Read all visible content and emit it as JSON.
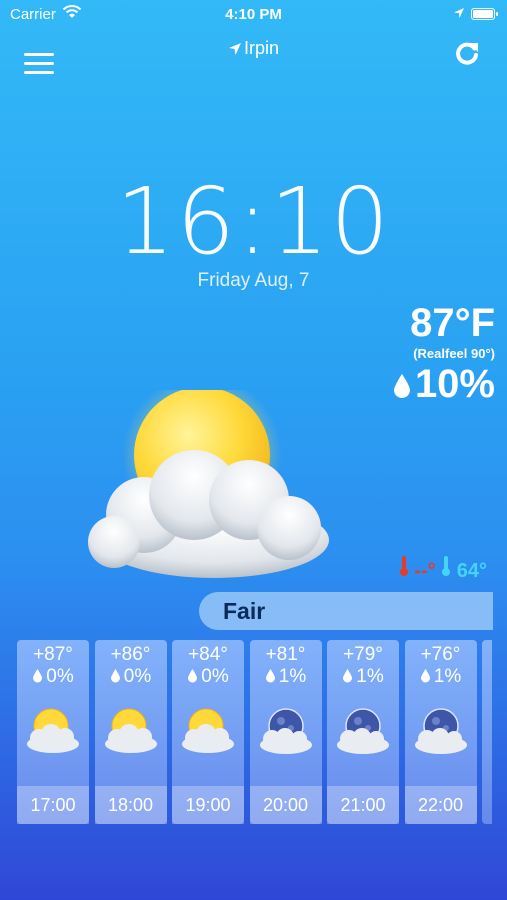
{
  "status_bar": {
    "carrier": "Carrier",
    "time": "4:10 PM"
  },
  "header": {
    "location": "Irpin"
  },
  "clock": {
    "time": "16:10",
    "date": "Friday Aug, 7"
  },
  "current": {
    "temperature": "87°F",
    "realfeel": "(Realfeel 90°)",
    "precipitation": "10%",
    "min_temp": "--°",
    "max_temp": "64°"
  },
  "condition": "Fair",
  "hourly": [
    {
      "temp": "+87°",
      "precip": "0%",
      "time": "17:00",
      "icon": "sun-cloud-icon"
    },
    {
      "temp": "+86°",
      "precip": "0%",
      "time": "18:00",
      "icon": "sun-cloud-icon"
    },
    {
      "temp": "+84°",
      "precip": "0%",
      "time": "19:00",
      "icon": "sun-cloud-icon"
    },
    {
      "temp": "+81°",
      "precip": "1%",
      "time": "20:00",
      "icon": "moon-cloud-icon"
    },
    {
      "temp": "+79°",
      "precip": "1%",
      "time": "21:00",
      "icon": "moon-cloud-icon"
    },
    {
      "temp": "+76°",
      "precip": "1%",
      "time": "22:00",
      "icon": "moon-cloud-icon"
    }
  ],
  "colors": {
    "min_temp": "#e83a2a",
    "max_temp": "#44d4f6",
    "condition_text": "#0a2a5a"
  }
}
